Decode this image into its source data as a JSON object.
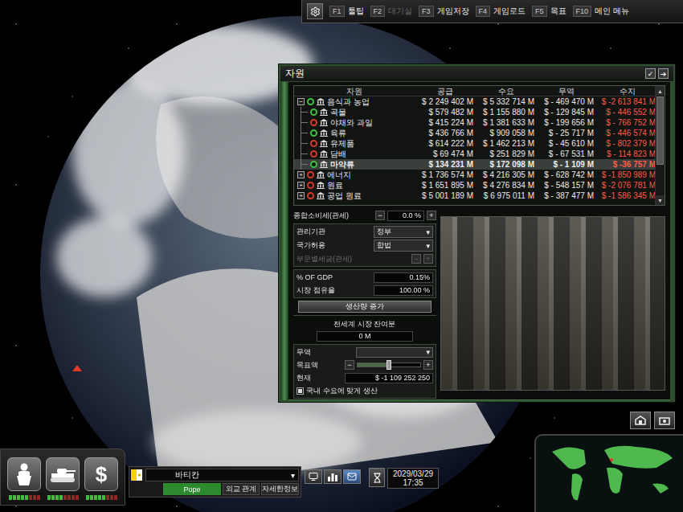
{
  "toolbar": {
    "items": [
      {
        "key": "F1",
        "label": "툴팁",
        "disabled": false
      },
      {
        "key": "F2",
        "label": "대기실",
        "disabled": true
      },
      {
        "key": "F3",
        "label": "게임저장",
        "disabled": false
      },
      {
        "key": "F4",
        "label": "게임로드",
        "disabled": false
      },
      {
        "key": "F5",
        "label": "목표",
        "disabled": false
      },
      {
        "key": "F10",
        "label": "메인 메뉴",
        "disabled": false
      }
    ]
  },
  "window": {
    "title": "자원",
    "buttons": [
      "✓",
      "➔"
    ]
  },
  "table": {
    "columns": [
      "자원",
      "공급",
      "수요",
      "무역",
      "수지"
    ],
    "rows": [
      {
        "kind": "category",
        "name": "음식과 농업",
        "toggle": "−",
        "expanded": true,
        "color": "#3fbf3f",
        "supply": "$ 2 249 402 M",
        "demand": "$ 5 332 714 M",
        "trade": "$ - 469 470 M",
        "balance": "$ -2 613 841 M",
        "selected": false
      },
      {
        "kind": "item",
        "name": "곡물",
        "color": "#3fbf3f",
        "supply": "$ 579 482 M",
        "demand": "$ 1 155 880 M",
        "trade": "$ - 129 845 M",
        "balance": "$ - 446 552 M",
        "selected": false
      },
      {
        "kind": "item",
        "name": "야채와 과일",
        "color": "#d43a2a",
        "supply": "$ 415 224 M",
        "demand": "$ 1 381 633 M",
        "trade": "$ - 199 656 M",
        "balance": "$ - 766 752 M",
        "selected": false
      },
      {
        "kind": "item",
        "name": "육류",
        "color": "#3fbf3f",
        "supply": "$ 436 766 M",
        "demand": "$ 909 058 M",
        "trade": "$ - 25 717 M",
        "balance": "$ - 446 574 M",
        "selected": false
      },
      {
        "kind": "item",
        "name": "유제품",
        "color": "#d43a2a",
        "supply": "$ 614 222 M",
        "demand": "$ 1 462 213 M",
        "trade": "$ - 45 610 M",
        "balance": "$ - 802 379 M",
        "selected": false
      },
      {
        "kind": "item",
        "name": "담배",
        "color": "#d43a2a",
        "supply": "$ 69 474 M",
        "demand": "$ 251 829 M",
        "trade": "$ - 67 531 M",
        "balance": "$ - 114 823 M",
        "selected": false
      },
      {
        "kind": "item",
        "name": "마약류",
        "color": "#3fbf3f",
        "supply": "$ 134 231 M",
        "demand": "$ 172 098 M",
        "trade": "$ - 1 109 M",
        "balance": "$ -36 757 M",
        "selected": true
      },
      {
        "kind": "category",
        "name": "에너지",
        "toggle": "+",
        "expanded": false,
        "color": "#d43a2a",
        "supply": "$ 1 736 574 M",
        "demand": "$ 4 216 305 M",
        "trade": "$ - 628 742 M",
        "balance": "$ -1 850 989 M",
        "selected": false
      },
      {
        "kind": "category",
        "name": "원료",
        "toggle": "+",
        "expanded": false,
        "color": "#d43a2a",
        "supply": "$ 1 651 895 M",
        "demand": "$ 4 276 834 M",
        "trade": "$ - 548 157 M",
        "balance": "$ -2 076 781 M",
        "selected": false
      },
      {
        "kind": "category",
        "name": "공업 원료",
        "toggle": "+",
        "expanded": false,
        "color": "#d43a2a",
        "supply": "$ 5 001 189 M",
        "demand": "$ 6 975 011 M",
        "trade": "$ - 387 477 M",
        "balance": "$ -1 586 345 M",
        "selected": false
      }
    ],
    "scrollbar": {
      "up": "▲",
      "down": "▼",
      "level": 0.7
    }
  },
  "controls": {
    "arrow": "▾",
    "consumption_tax": {
      "label": "종합소비세(관세)",
      "value": "0.0 %",
      "minus": "−",
      "plus": "+"
    },
    "manager": {
      "label": "관리기관",
      "value": "정부"
    },
    "legality": {
      "label": "국가허용",
      "value": "합법"
    },
    "sector_tax": {
      "label": "부문별세금(관세)",
      "minus": "−",
      "plus": "+",
      "disabled": true
    },
    "gdp": {
      "label": "% OF GDP",
      "value": "0.15%"
    },
    "market_share": {
      "label": "시장 점유율",
      "value": "100.00 %"
    },
    "increase_button": "생산량 증가",
    "world_market": {
      "label": "전세계 시장 잔여분",
      "value": "0 M"
    },
    "trade": {
      "label": "무역",
      "value": ""
    },
    "target": {
      "label": "목표액",
      "minus": "−",
      "plus": "+",
      "level": 0.5
    },
    "current": {
      "label": "현재",
      "value": "$ -1 109 252 250"
    },
    "domestic": {
      "label": "국내 수요에 맞게 생산",
      "checked": true
    }
  },
  "hud": {
    "buttons": [
      {
        "kind": "politics",
        "symbol": "",
        "level": 0.6
      },
      {
        "kind": "military",
        "symbol": "",
        "level": 0.5
      },
      {
        "kind": "economy",
        "symbol": "$",
        "level": 0.6
      }
    ],
    "country": {
      "name": "바티칸",
      "leader": "Pope",
      "tabs": [
        "외교 관계",
        "자세한정보"
      ]
    },
    "views": [
      {
        "kind": "monitor",
        "selected": false
      },
      {
        "kind": "chart",
        "selected": false
      },
      {
        "kind": "mail",
        "selected": true
      }
    ],
    "clock": {
      "date": "2029/03/29",
      "time": "17:35"
    }
  }
}
